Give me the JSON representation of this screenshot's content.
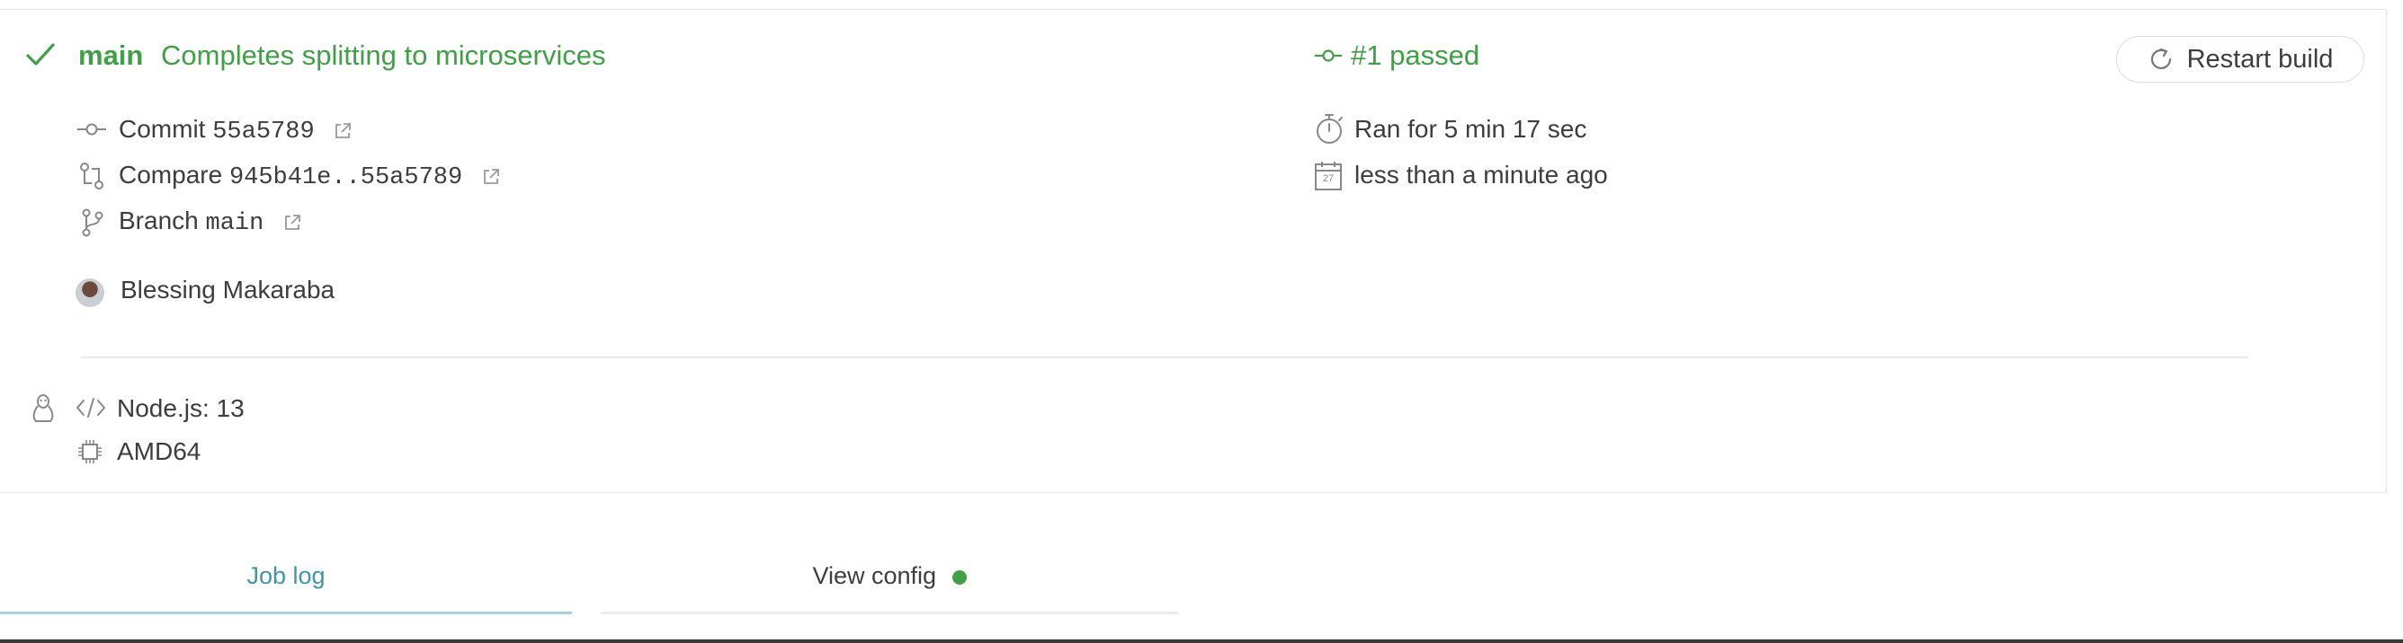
{
  "header": {
    "branch": "main",
    "commit_message": "Completes splitting to microservices",
    "build_status": "#1 passed",
    "restart_label": "Restart build"
  },
  "meta": {
    "commit_label": "Commit",
    "commit_sha": "55a5789",
    "compare_label": "Compare",
    "compare_range": "945b41e..55a5789",
    "branch_label": "Branch",
    "branch_value": "main",
    "author": "Blessing Makaraba",
    "duration": "Ran for 5 min 17 sec",
    "finished": "less than a minute ago",
    "calendar_day": "27"
  },
  "job": {
    "language": "Node.js: 13",
    "arch": "AMD64"
  },
  "tabs": [
    {
      "label": "Job log",
      "active": true
    },
    {
      "label": "View config",
      "active": false
    }
  ],
  "colors": {
    "passed": "#40a045",
    "status_bar": "#5fb15b",
    "active_tab": "#3d97a6",
    "active_tab_underline": "#a6d4dd"
  },
  "icons": [
    "check-icon",
    "commit-icon",
    "compare-icon",
    "branch-icon",
    "external-link-icon",
    "stopwatch-icon",
    "calendar-icon",
    "restart-icon",
    "linux-icon",
    "code-icon",
    "cpu-icon",
    "status-dot-icon"
  ]
}
